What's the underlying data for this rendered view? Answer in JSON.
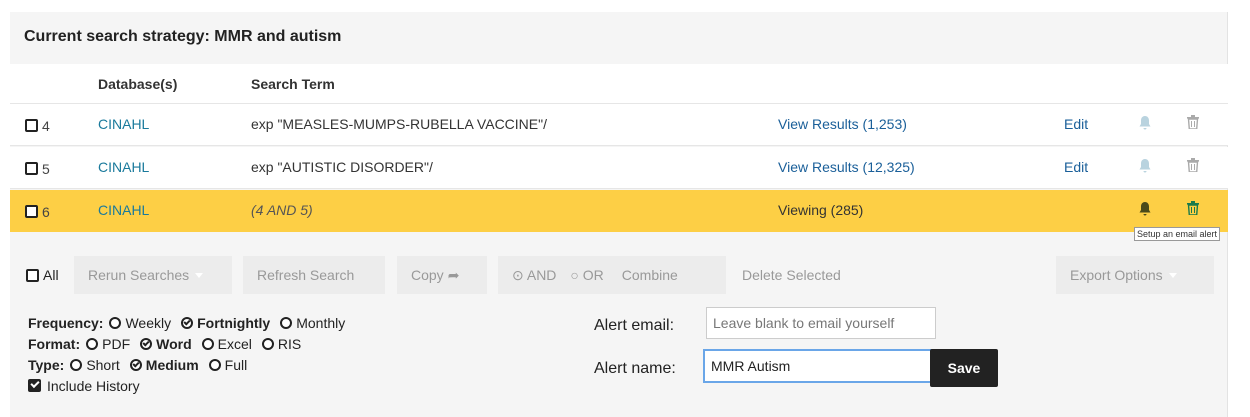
{
  "title": "Current search strategy: MMR and autism",
  "columns": {
    "database": "Database(s)",
    "term": "Search Term"
  },
  "rows": [
    {
      "num": "4",
      "db": "CINAHL",
      "term": "exp \"MEASLES-MUMPS-RUBELLA VACCINE\"/",
      "result": "View Results (1,253)",
      "edit": "Edit"
    },
    {
      "num": "5",
      "db": "CINAHL",
      "term": "exp \"AUTISTIC DISORDER\"/",
      "result": "View Results (12,325)",
      "edit": "Edit"
    },
    {
      "num": "6",
      "db": "CINAHL",
      "term": "(4 AND 5)",
      "result": "Viewing (285)",
      "edit": ""
    }
  ],
  "tooltip": "Setup an email alert",
  "toolbar": {
    "all": "All",
    "rerun": "Rerun Searches",
    "refresh": "Refresh Search",
    "copy": "Copy",
    "and": "AND",
    "or": "OR",
    "combine": "Combine",
    "delete": "Delete Selected",
    "export": "Export Options"
  },
  "options": {
    "frequency_label": "Frequency:",
    "frequency": [
      "Weekly",
      "Fortnightly",
      "Monthly"
    ],
    "frequency_selected": "Fortnightly",
    "format_label": "Format:",
    "format": [
      "PDF",
      "Word",
      "Excel",
      "RIS"
    ],
    "format_selected": "Word",
    "type_label": "Type:",
    "type": [
      "Short",
      "Medium",
      "Full"
    ],
    "type_selected": "Medium",
    "include_history": "Include History"
  },
  "alert": {
    "email_label": "Alert email:",
    "email_placeholder": "Leave blank to email yourself",
    "name_label": "Alert name:",
    "name_value": "MMR Autism",
    "save": "Save"
  },
  "colors": {
    "selected_row": "#fdcf45",
    "link": "#1a5f99",
    "db_link": "#1a7a9c"
  }
}
